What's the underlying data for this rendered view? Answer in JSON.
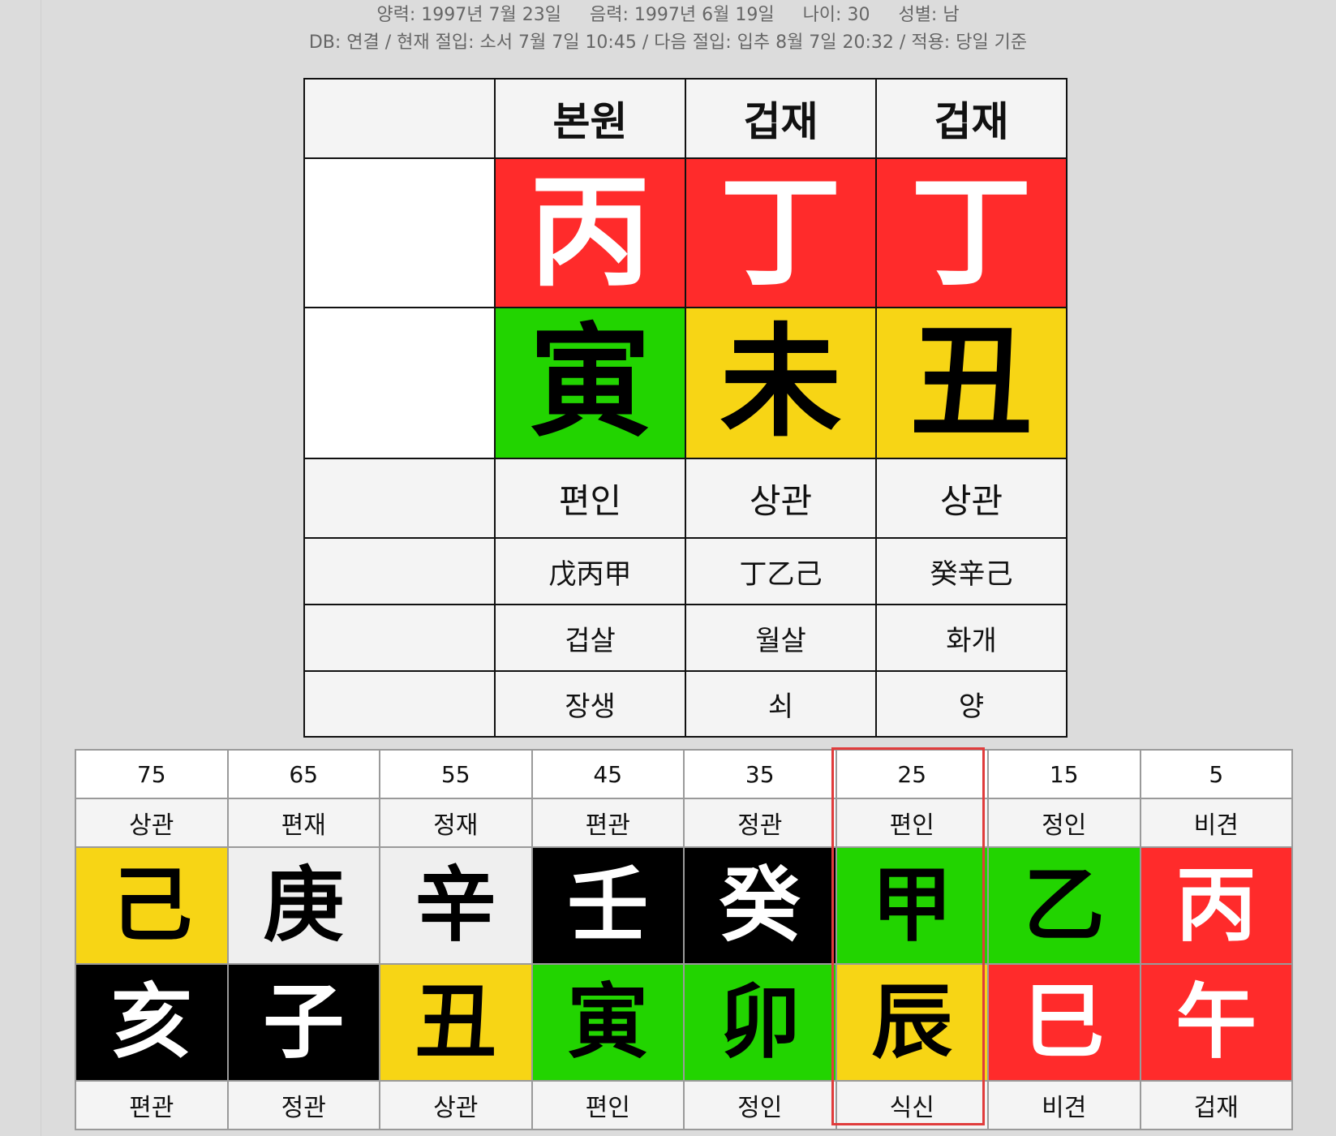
{
  "info": {
    "solar": "양력: 1997년 7월 23일",
    "lunar": "음력: 1997년 6월 19일",
    "age": "나이: 30",
    "gender": "성별: 남",
    "line2": "DB: 연결 / 현재 절입: 소서 7월 7일 10:45 / 다음 절입: 입추 8월 7일 20:32 / 적용: 당일 기준"
  },
  "pillars": {
    "columns": [
      {
        "header": "본원",
        "stem": {
          "char": "丙",
          "bg": "#ff2b2b",
          "fg": "#ffffff"
        },
        "branch": {
          "char": "寅",
          "bg": "#22d400",
          "fg": "#000000"
        },
        "ten_god": "편인",
        "hidden": "戊丙甲",
        "sinsal": "겁살",
        "stage": "장생"
      },
      {
        "header": "겁재",
        "stem": {
          "char": "丁",
          "bg": "#ff2b2b",
          "fg": "#ffffff"
        },
        "branch": {
          "char": "未",
          "bg": "#f7d515",
          "fg": "#000000"
        },
        "ten_god": "상관",
        "hidden": "丁乙己",
        "sinsal": "월살",
        "stage": "쇠"
      },
      {
        "header": "겁재",
        "stem": {
          "char": "丁",
          "bg": "#ff2b2b",
          "fg": "#ffffff"
        },
        "branch": {
          "char": "丑",
          "bg": "#f7d515",
          "fg": "#000000"
        },
        "ten_god": "상관",
        "hidden": "癸辛己",
        "sinsal": "화개",
        "stage": "양"
      }
    ]
  },
  "luck": {
    "selected_age": "25",
    "columns": [
      {
        "age": "75",
        "top_label": "상관",
        "stem": {
          "char": "己",
          "bg": "#f7d515",
          "fg": "#000000"
        },
        "branch": {
          "char": "亥",
          "bg": "#000000",
          "fg": "#ffffff"
        },
        "bottom_label": "편관"
      },
      {
        "age": "65",
        "top_label": "편재",
        "stem": {
          "char": "庚",
          "bg": "#efefef",
          "fg": "#000000"
        },
        "branch": {
          "char": "子",
          "bg": "#000000",
          "fg": "#ffffff"
        },
        "bottom_label": "정관"
      },
      {
        "age": "55",
        "top_label": "정재",
        "stem": {
          "char": "辛",
          "bg": "#efefef",
          "fg": "#000000"
        },
        "branch": {
          "char": "丑",
          "bg": "#f7d515",
          "fg": "#000000"
        },
        "bottom_label": "상관"
      },
      {
        "age": "45",
        "top_label": "편관",
        "stem": {
          "char": "壬",
          "bg": "#000000",
          "fg": "#ffffff"
        },
        "branch": {
          "char": "寅",
          "bg": "#22d400",
          "fg": "#000000"
        },
        "bottom_label": "편인"
      },
      {
        "age": "35",
        "top_label": "정관",
        "stem": {
          "char": "癸",
          "bg": "#000000",
          "fg": "#ffffff"
        },
        "branch": {
          "char": "卯",
          "bg": "#22d400",
          "fg": "#000000"
        },
        "bottom_label": "정인"
      },
      {
        "age": "25",
        "top_label": "편인",
        "stem": {
          "char": "甲",
          "bg": "#22d400",
          "fg": "#000000"
        },
        "branch": {
          "char": "辰",
          "bg": "#f7d515",
          "fg": "#000000"
        },
        "bottom_label": "식신"
      },
      {
        "age": "15",
        "top_label": "정인",
        "stem": {
          "char": "乙",
          "bg": "#22d400",
          "fg": "#000000"
        },
        "branch": {
          "char": "巳",
          "bg": "#ff2b2b",
          "fg": "#ffffff"
        },
        "bottom_label": "비견"
      },
      {
        "age": "5",
        "top_label": "비견",
        "stem": {
          "char": "丙",
          "bg": "#ff2b2b",
          "fg": "#ffffff"
        },
        "branch": {
          "char": "午",
          "bg": "#ff2b2b",
          "fg": "#ffffff"
        },
        "bottom_label": "겁재"
      }
    ]
  },
  "colors": {
    "fire": "#ff2b2b",
    "wood": "#22d400",
    "earth": "#f7d515",
    "metal": "#efefef",
    "water": "#000000",
    "selection": "#e03c3c"
  }
}
